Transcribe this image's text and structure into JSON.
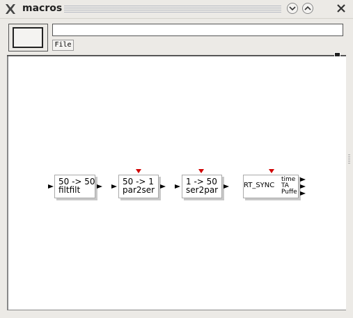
{
  "window": {
    "title": "macros"
  },
  "header": {
    "name_value": "",
    "file_label": "File"
  },
  "blocks": [
    {
      "line1": "50 -> 50",
      "line2": "filtfilt"
    },
    {
      "line1": "50 -> 1",
      "line2": "par2ser"
    },
    {
      "line1": "1 -> 50",
      "line2": "ser2par"
    },
    {
      "label": "RT_SYNC",
      "outputs": [
        "time",
        "TA",
        "Puffe"
      ]
    }
  ],
  "colors": {
    "trigger": "#d00000",
    "canvas": "#ffffff"
  }
}
